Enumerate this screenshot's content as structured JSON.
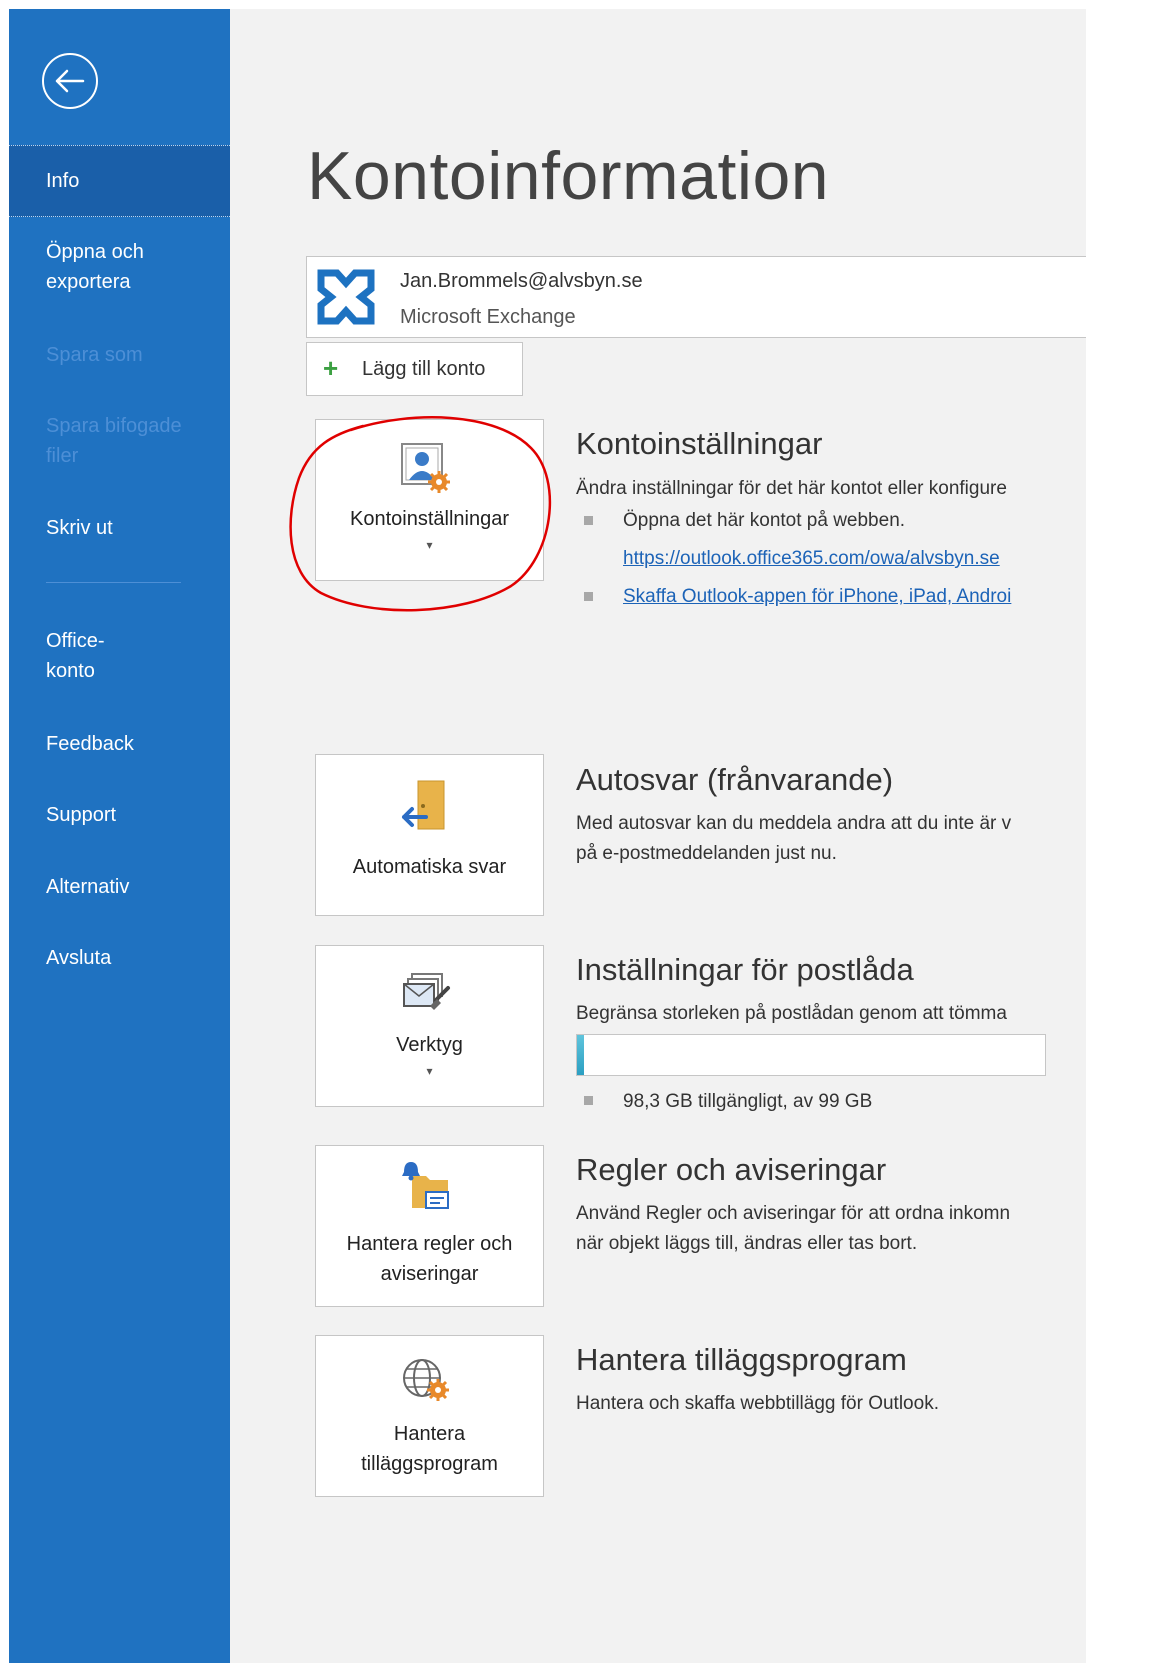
{
  "sidebar": {
    "items": [
      {
        "label": "Info",
        "state": "active"
      },
      {
        "label": "Öppna och exportera",
        "lines": [
          "Öppna och",
          "exportera"
        ],
        "state": "enabled"
      },
      {
        "label": "Spara som",
        "state": "disabled"
      },
      {
        "label": "Spara bifogade filer",
        "lines": [
          "Spara bifogade",
          "filer"
        ],
        "state": "disabled"
      },
      {
        "label": "Skriv ut",
        "state": "enabled"
      },
      {
        "label": "Office-konto",
        "lines": [
          "Office-",
          "konto"
        ],
        "state": "enabled"
      },
      {
        "label": "Feedback",
        "state": "enabled"
      },
      {
        "label": "Support",
        "state": "enabled"
      },
      {
        "label": "Alternativ",
        "state": "enabled"
      },
      {
        "label": "Avsluta",
        "state": "enabled"
      }
    ]
  },
  "page": {
    "title": "Kontoinformation"
  },
  "account": {
    "email": "Jan.Brommels@alvsbyn.se",
    "type": "Microsoft Exchange",
    "icon": "exchange-icon"
  },
  "add_account": {
    "label": "Lägg till konto",
    "icon": "plus-icon"
  },
  "sections": {
    "account_settings": {
      "tile_label": "Kontoinställningar",
      "heading": "Kontoinställningar",
      "description": "Ändra inställningar för det här kontot eller konfigure",
      "bullets": [
        {
          "text": "Öppna det här kontot på webben.",
          "link": "https://outlook.office365.com/owa/alvsbyn.se"
        },
        {
          "link": "Skaffa Outlook-appen för iPhone, iPad, Androi"
        }
      ],
      "icon": "account-settings-icon"
    },
    "auto_reply": {
      "tile_label": "Automatiska svar",
      "heading": "Autosvar (frånvarande)",
      "description_lines": [
        "Med autosvar kan du meddela andra att du inte är v",
        "på e-postmeddelanden just nu."
      ],
      "icon": "auto-reply-door-icon"
    },
    "mailbox": {
      "tile_label": "Verktyg",
      "heading": "Inställningar för postlåda",
      "description": "Begränsa storleken på postlådan genom att tömma",
      "usage_text": "98,3 GB tillgängligt, av 99 GB",
      "used_fraction": 0.007,
      "icon": "tools-icon"
    },
    "rules": {
      "tile_label_lines": [
        "Hantera regler och",
        "aviseringar"
      ],
      "heading": "Regler och aviseringar",
      "description_lines": [
        "Använd Regler och aviseringar för att ordna inkomn",
        "när objekt läggs till, ändras eller tas bort."
      ],
      "icon": "rules-alerts-icon"
    },
    "addins": {
      "tile_label_lines": [
        "Hantera",
        "tilläggsprogram"
      ],
      "heading": "Hantera tilläggsprogram",
      "description": "Hantera och skaffa webbtillägg för Outlook.",
      "icon": "globe-gear-icon"
    }
  },
  "colors": {
    "sidebar": "#1f72c1",
    "accent_gear": "#e8892a",
    "link": "#1c63b7",
    "annotation": "#e00000"
  }
}
